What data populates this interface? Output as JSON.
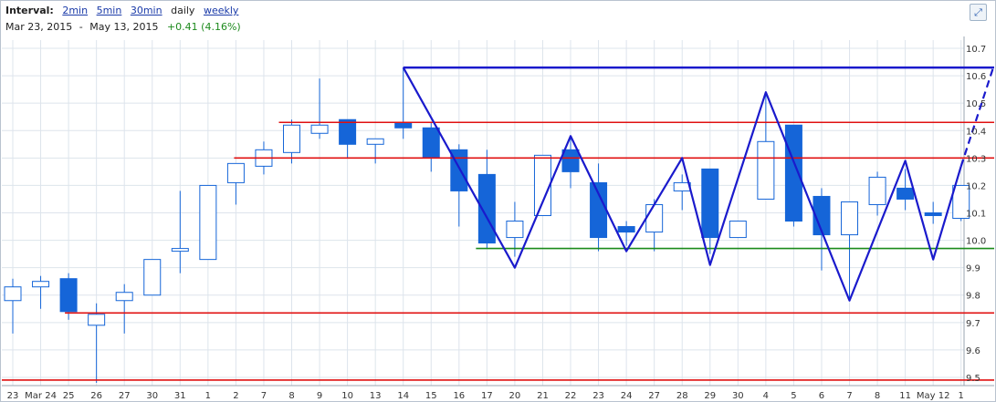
{
  "header": {
    "interval_label": "Interval:",
    "interval_options": [
      "2min",
      "5min",
      "30min"
    ],
    "current_interval": "daily",
    "weekly_option": "weekly",
    "date_range_start": "Mar 23, 2015",
    "date_range_sep": "-",
    "date_range_end": "May 13, 2015",
    "change": "+0.41 (4.16%)"
  },
  "colors": {
    "down_candle": "#1565d8",
    "up_candle_fill": "#ffffff",
    "candle_outline": "#1565d8",
    "support_resistance": "#e01010",
    "green_line": "#1a8a1a",
    "pattern_line": "#1a1acc",
    "grid": "#dde4ec"
  },
  "expand_icon": "expand-arrows-icon",
  "chart_data": {
    "type": "candlestick",
    "yaxis": {
      "position": "right",
      "ylim": [
        9.47,
        10.73
      ],
      "ticks": [
        9.5,
        9.6,
        9.7,
        9.8,
        9.9,
        10.0,
        10.1,
        10.2,
        10.3,
        10.4,
        10.5,
        10.6,
        10.7
      ],
      "tick_labels": [
        "9.5",
        "9.6",
        "9.7",
        "9.8",
        "9.9",
        "10.0",
        "10.1",
        "10.2",
        "10.3",
        "10.4",
        "10.5",
        "10.6",
        "10.7"
      ]
    },
    "x_labels": [
      "23",
      "Mar 24",
      "25",
      "26",
      "27",
      "30",
      "31",
      "1",
      "2",
      "7",
      "8",
      "9",
      "10",
      "13",
      "14",
      "15",
      "16",
      "17",
      "20",
      "21",
      "22",
      "23",
      "24",
      "27",
      "28",
      "29",
      "30",
      "4",
      "5",
      "6",
      "7",
      "8",
      "11",
      "May 12",
      "1"
    ],
    "candles": [
      {
        "o": 9.78,
        "h": 9.86,
        "l": 9.66,
        "c": 9.83
      },
      {
        "o": 9.83,
        "h": 9.87,
        "l": 9.75,
        "c": 9.85
      },
      {
        "o": 9.86,
        "h": 9.88,
        "l": 9.71,
        "c": 9.74
      },
      {
        "o": 9.69,
        "h": 9.77,
        "l": 9.48,
        "c": 9.73
      },
      {
        "o": 9.78,
        "h": 9.84,
        "l": 9.66,
        "c": 9.81
      },
      {
        "o": 9.8,
        "h": 9.93,
        "l": 9.8,
        "c": 9.93
      },
      {
        "o": 9.96,
        "h": 10.18,
        "l": 9.88,
        "c": 9.97
      },
      {
        "o": 9.93,
        "h": 10.2,
        "l": 9.93,
        "c": 10.2
      },
      {
        "o": 10.21,
        "h": 10.27,
        "l": 10.13,
        "c": 10.28
      },
      {
        "o": 10.27,
        "h": 10.36,
        "l": 10.24,
        "c": 10.33
      },
      {
        "o": 10.32,
        "h": 10.44,
        "l": 10.28,
        "c": 10.42
      },
      {
        "o": 10.39,
        "h": 10.59,
        "l": 10.37,
        "c": 10.42
      },
      {
        "o": 10.44,
        "h": 10.44,
        "l": 10.3,
        "c": 10.35
      },
      {
        "o": 10.35,
        "h": 10.37,
        "l": 10.28,
        "c": 10.37
      },
      {
        "o": 10.43,
        "h": 10.63,
        "l": 10.37,
        "c": 10.41
      },
      {
        "o": 10.41,
        "h": 10.43,
        "l": 10.25,
        "c": 10.3
      },
      {
        "o": 10.33,
        "h": 10.35,
        "l": 10.05,
        "c": 10.18
      },
      {
        "o": 10.24,
        "h": 10.33,
        "l": 9.97,
        "c": 9.99
      },
      {
        "o": 10.01,
        "h": 10.14,
        "l": 9.94,
        "c": 10.07
      },
      {
        "o": 10.09,
        "h": 10.31,
        "l": 10.09,
        "c": 10.31
      },
      {
        "o": 10.33,
        "h": 10.38,
        "l": 10.19,
        "c": 10.25
      },
      {
        "o": 10.21,
        "h": 10.28,
        "l": 9.96,
        "c": 10.01
      },
      {
        "o": 10.05,
        "h": 10.07,
        "l": 9.98,
        "c": 10.03
      },
      {
        "o": 10.03,
        "h": 10.15,
        "l": 9.96,
        "c": 10.13
      },
      {
        "o": 10.18,
        "h": 10.24,
        "l": 10.11,
        "c": 10.21
      },
      {
        "o": 10.26,
        "h": 10.26,
        "l": 9.95,
        "c": 10.01
      },
      {
        "o": 10.01,
        "h": 10.07,
        "l": 10.01,
        "c": 10.07
      },
      {
        "o": 10.15,
        "h": 10.53,
        "l": 10.15,
        "c": 10.36
      },
      {
        "o": 10.42,
        "h": 10.42,
        "l": 10.05,
        "c": 10.07
      },
      {
        "o": 10.16,
        "h": 10.19,
        "l": 9.89,
        "c": 10.02
      },
      {
        "o": 10.02,
        "h": 10.14,
        "l": 9.79,
        "c": 10.14
      },
      {
        "o": 10.13,
        "h": 10.25,
        "l": 10.09,
        "c": 10.23
      },
      {
        "o": 10.19,
        "h": 10.26,
        "l": 10.11,
        "c": 10.15
      },
      {
        "o": 10.1,
        "h": 10.14,
        "l": 10.06,
        "c": 10.09
      },
      {
        "o": 10.08,
        "h": 10.2,
        "l": 10.07,
        "c": 10.2
      }
    ],
    "horizontal_lines": [
      {
        "y": 10.63,
        "color": "blue",
        "style": "solid"
      },
      {
        "y": 10.43,
        "color": "red"
      },
      {
        "y": 10.3,
        "color": "red"
      },
      {
        "y": 9.97,
        "color": "green"
      },
      {
        "y": 9.735,
        "color": "red"
      },
      {
        "y": 9.49,
        "color": "red"
      }
    ],
    "pattern_polyline": [
      {
        "i": 14,
        "y": 10.63
      },
      {
        "i": 18,
        "y": 9.9
      },
      {
        "i": 20,
        "y": 10.38
      },
      {
        "i": 22,
        "y": 9.96
      },
      {
        "i": 24,
        "y": 10.3
      },
      {
        "i": 25,
        "y": 9.91
      },
      {
        "i": 27,
        "y": 10.54
      },
      {
        "i": 30,
        "y": 9.78
      },
      {
        "i": 32,
        "y": 10.29
      },
      {
        "i": 33,
        "y": 9.93
      },
      {
        "i": 34,
        "y": 10.27
      }
    ],
    "pattern_dashed_extension": [
      {
        "i": 34,
        "y": 10.27
      },
      {
        "i": 34.1,
        "y": 10.63
      }
    ]
  }
}
